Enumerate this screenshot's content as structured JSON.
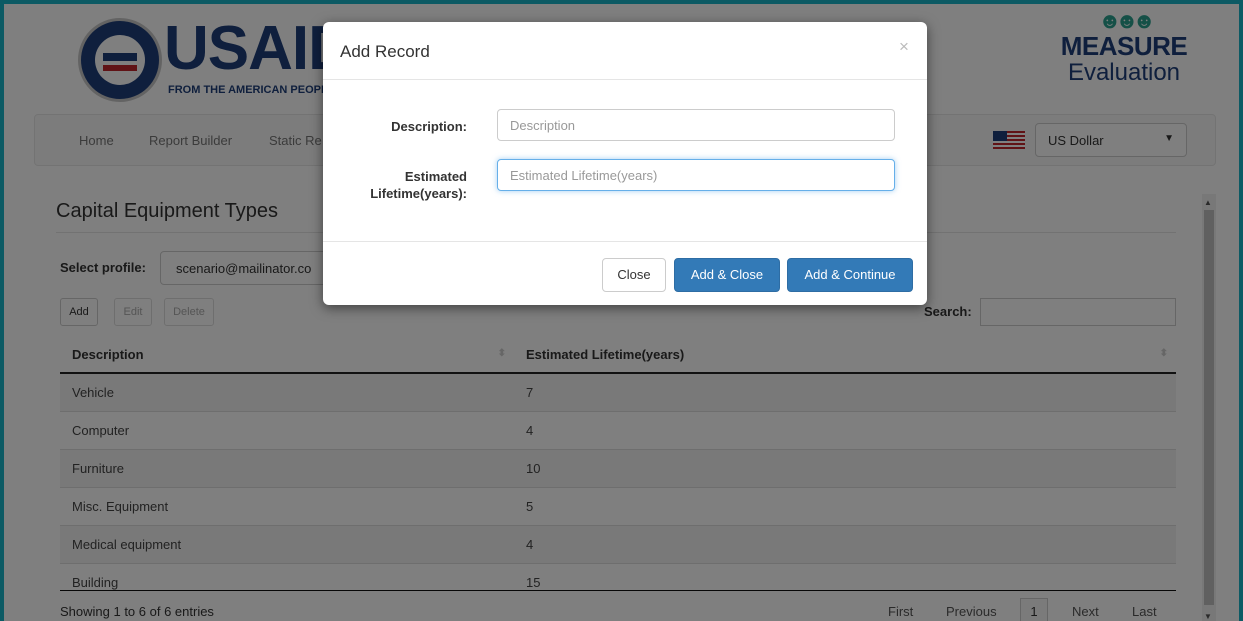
{
  "header": {
    "usaid_logo_text": "USAID",
    "usaid_tagline": "FROM THE AMERICAN PEOPLE",
    "measure_word": "MEASURE",
    "evaluation_word": "Evaluation"
  },
  "navbar": {
    "items": [
      "Home",
      "Report Builder",
      "Static Re"
    ],
    "currency": "US Dollar"
  },
  "page": {
    "title": "Capital Equipment Types",
    "profile_label": "Select profile:",
    "profile_value": "scenario@mailinator.co",
    "buttons": {
      "add": "Add",
      "edit": "Edit",
      "delete": "Delete"
    },
    "search_label": "Search:"
  },
  "table": {
    "columns": [
      "Description",
      "Estimated Lifetime(years)"
    ],
    "rows": [
      [
        "Vehicle",
        "7"
      ],
      [
        "Computer",
        "4"
      ],
      [
        "Furniture",
        "10"
      ],
      [
        "Misc. Equipment",
        "5"
      ],
      [
        "Medical equipment",
        "4"
      ],
      [
        "Building",
        "15"
      ]
    ],
    "info": "Showing 1 to 6 of 6 entries",
    "pagination": {
      "first": "First",
      "previous": "Previous",
      "current": "1",
      "next": "Next",
      "last": "Last"
    }
  },
  "modal": {
    "title": "Add Record",
    "close_symbol": "×",
    "fields": {
      "description_label": "Description:",
      "description_placeholder": "Description",
      "lifetime_label_line1": "Estimated",
      "lifetime_label_line2": "Lifetime(years):",
      "lifetime_placeholder": "Estimated Lifetime(years)"
    },
    "buttons": {
      "close": "Close",
      "add_close": "Add & Close",
      "add_continue": "Add & Continue"
    }
  },
  "colors": {
    "primary": "#337ab7",
    "frame": "#19b5c9",
    "usaid_blue": "#1f3f7a",
    "usaid_red": "#c0262d"
  }
}
